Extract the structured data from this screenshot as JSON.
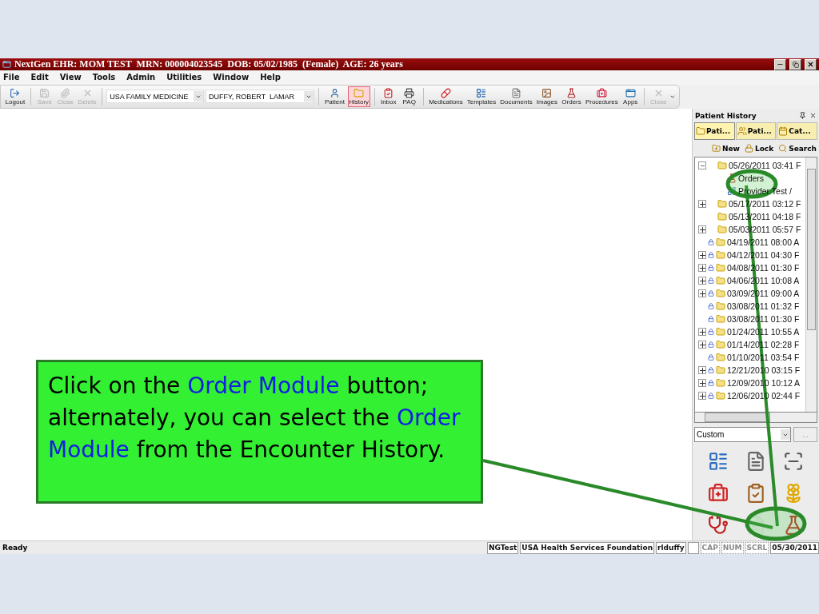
{
  "window": {
    "title": "NextGen EHR: MOM TEST  MRN: 000004023545  DOB: 05/02/1985  (Female)  AGE: 26 years"
  },
  "menu": [
    "File",
    "Edit",
    "View",
    "Tools",
    "Admin",
    "Utilities",
    "Window",
    "Help"
  ],
  "toolbar": {
    "left_tools": [
      {
        "label": "Logout",
        "kind": "logout",
        "disabled": false
      },
      {
        "label": "Save",
        "kind": "save",
        "disabled": true
      },
      {
        "label": "Close",
        "kind": "attach",
        "disabled": true
      },
      {
        "label": "Delete",
        "kind": "delete",
        "disabled": true
      }
    ],
    "location": "USA FAMILY MEDICINE",
    "provider": "DUFFY, ROBERT  LAMAR",
    "tools": [
      {
        "label": "Patient",
        "kind": "patient",
        "selected": false,
        "disabled": false
      },
      {
        "label": "History",
        "kind": "history",
        "selected": true,
        "disabled": false
      },
      {
        "label": "Inbox",
        "kind": "inbox",
        "selected": false,
        "disabled": false
      },
      {
        "label": "PAQ",
        "kind": "paq",
        "selected": false,
        "disabled": false
      },
      {
        "label": "Medications",
        "kind": "meds",
        "selected": false,
        "disabled": false
      },
      {
        "label": "Templates",
        "kind": "templates",
        "selected": false,
        "disabled": false
      },
      {
        "label": "Documents",
        "kind": "documents",
        "selected": false,
        "disabled": false
      },
      {
        "label": "Images",
        "kind": "images",
        "selected": false,
        "disabled": false
      },
      {
        "label": "Orders",
        "kind": "orders",
        "selected": false,
        "disabled": false
      },
      {
        "label": "Procedures",
        "kind": "procedures",
        "selected": false,
        "disabled": false
      },
      {
        "label": "Apps",
        "kind": "apps",
        "selected": false,
        "disabled": false
      },
      {
        "label": "Close",
        "kind": "close",
        "selected": false,
        "disabled": true
      }
    ]
  },
  "panel": {
    "title": "Patient History",
    "tabs": [
      {
        "label": "Pati...",
        "kind": "folder",
        "selected": true
      },
      {
        "label": "Pati...",
        "kind": "people",
        "selected": false
      },
      {
        "label": "Cat...",
        "kind": "calendar",
        "selected": false
      }
    ],
    "actions": [
      {
        "label": "New",
        "kind": "new"
      },
      {
        "label": "Lock",
        "kind": "lock"
      },
      {
        "label": "Search",
        "kind": "search"
      }
    ],
    "tree": [
      {
        "label": "05/26/2011 03:41 F",
        "expanded": true,
        "locked": false,
        "children": [
          {
            "label": "Orders",
            "kind": "orders"
          },
          {
            "label": "Provider Test /",
            "kind": "document"
          }
        ]
      },
      {
        "label": "05/17/2011 03:12 F",
        "expanded": false,
        "locked": false
      },
      {
        "label": "05/13/2011 04:18 F",
        "locked": false
      },
      {
        "label": "05/03/2011 05:57 F",
        "expanded": false,
        "locked": false
      },
      {
        "label": "04/19/2011 08:00 A",
        "locked": true
      },
      {
        "label": "04/12/2011 04:30 F",
        "expanded": false,
        "locked": true
      },
      {
        "label": "04/08/2011 01:30 F",
        "expanded": false,
        "locked": true
      },
      {
        "label": "04/06/2011 10:08 A",
        "expanded": false,
        "locked": true
      },
      {
        "label": "03/09/2011 09:00 A",
        "expanded": false,
        "locked": true
      },
      {
        "label": "03/08/2011 01:32 F",
        "locked": true
      },
      {
        "label": "03/08/2011 01:30 F",
        "locked": true
      },
      {
        "label": "01/24/2011 10:55 A",
        "expanded": false,
        "locked": true
      },
      {
        "label": "01/14/2011 02:28 F",
        "expanded": false,
        "locked": true
      },
      {
        "label": "01/10/2011 03:54 F",
        "locked": true
      },
      {
        "label": "12/21/2010 03:15 F",
        "expanded": false,
        "locked": true
      },
      {
        "label": "12/09/2010 10:12 A",
        "expanded": false,
        "locked": true
      },
      {
        "label": "12/06/2010 02:44 F",
        "expanded": false,
        "locked": true
      }
    ],
    "filter": "Custom",
    "more_button": "...",
    "modules": [
      {
        "kind": "list"
      },
      {
        "kind": "document"
      },
      {
        "kind": "xray"
      },
      {
        "kind": "medkit"
      },
      {
        "kind": "dx"
      },
      {
        "kind": "flower"
      },
      {
        "kind": "rx"
      },
      {
        "kind": "faded"
      },
      {
        "kind": "orders"
      }
    ]
  },
  "status_bar": {
    "text": "Ready",
    "panes": [
      {
        "text": "NGTest",
        "disabled": false
      },
      {
        "text": "USA Health Services Foundation",
        "disabled": false
      },
      {
        "text": "rlduffy",
        "disabled": false
      },
      {
        "disabled": false
      },
      {
        "text": "CAP",
        "disabled": true
      },
      {
        "text": "NUM",
        "disabled": true
      },
      {
        "text": "SCRL",
        "disabled": true
      },
      {
        "text": "05/30/2011",
        "disabled": false
      }
    ]
  },
  "callout": {
    "segments": [
      {
        "text": "Click on the ",
        "highlight": false
      },
      {
        "text": "Order Module",
        "highlight": true
      },
      {
        "text": " button; alternately, you can select the ",
        "highlight": false
      },
      {
        "text": "Order Module",
        "highlight": true
      },
      {
        "text": " from the Encounter History.",
        "highlight": false
      }
    ]
  }
}
